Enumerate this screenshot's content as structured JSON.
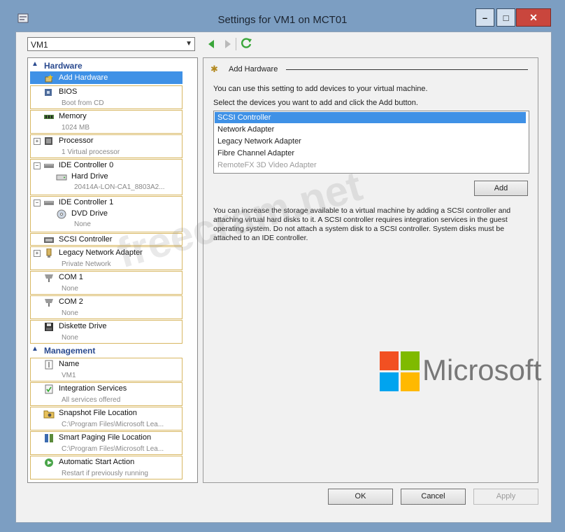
{
  "window": {
    "title": "Settings for VM1 on MCT01",
    "min_label": "–",
    "max_label": "□",
    "close_label": "✕"
  },
  "vm_selector": {
    "value": "VM1"
  },
  "tree": {
    "hardware_label": "Hardware",
    "management_label": "Management",
    "items": [
      {
        "label": "Add Hardware",
        "sub": ""
      },
      {
        "label": "BIOS",
        "sub": "Boot from CD"
      },
      {
        "label": "Memory",
        "sub": "1024 MB"
      },
      {
        "label": "Processor",
        "sub": "1 Virtual processor"
      },
      {
        "label": "IDE Controller 0",
        "child_label": "Hard Drive",
        "child_sub": "20414A-LON-CA1_8803A2..."
      },
      {
        "label": "IDE Controller 1",
        "child_label": "DVD Drive",
        "child_sub": "None"
      },
      {
        "label": "SCSI Controller",
        "sub": ""
      },
      {
        "label": "Legacy Network Adapter",
        "sub": "Private Network"
      },
      {
        "label": "COM 1",
        "sub": "None"
      },
      {
        "label": "COM 2",
        "sub": "None"
      },
      {
        "label": "Diskette Drive",
        "sub": "None"
      },
      {
        "label": "Name",
        "sub": "VM1"
      },
      {
        "label": "Integration Services",
        "sub": "All services offered"
      },
      {
        "label": "Snapshot File Location",
        "sub": "C:\\Program Files\\Microsoft Lea..."
      },
      {
        "label": "Smart Paging File Location",
        "sub": "C:\\Program Files\\Microsoft Lea..."
      },
      {
        "label": "Automatic Start Action",
        "sub": "Restart if previously running"
      }
    ]
  },
  "panel": {
    "group_title": "Add Hardware",
    "intro": "You can use this setting to add devices to your virtual machine.",
    "select_prompt": "Select the devices you want to add and click the Add button.",
    "devices": [
      "SCSI Controller",
      "Network Adapter",
      "Legacy Network Adapter",
      "Fibre Channel Adapter",
      "RemoteFX 3D Video Adapter"
    ],
    "selected_device": "SCSI Controller",
    "add_button": "Add",
    "info": "You can increase the storage available to a virtual machine by adding a SCSI controller and attaching virtual hard disks to it. A SCSI controller requires integration services in the guest operating system. Do not attach a system disk to a SCSI controller. System disks must be attached to an IDE controller."
  },
  "buttons": {
    "ok": "OK",
    "cancel": "Cancel",
    "apply": "Apply"
  },
  "watermark": "freecram.net",
  "brand": {
    "text": "Microsoft",
    "colors": [
      "#f25022",
      "#7fba00",
      "#00a4ef",
      "#ffb900"
    ]
  },
  "colors": {
    "selection": "#3f91e6",
    "section_header": "#2a4a8f",
    "item_border": "#d8b762"
  }
}
